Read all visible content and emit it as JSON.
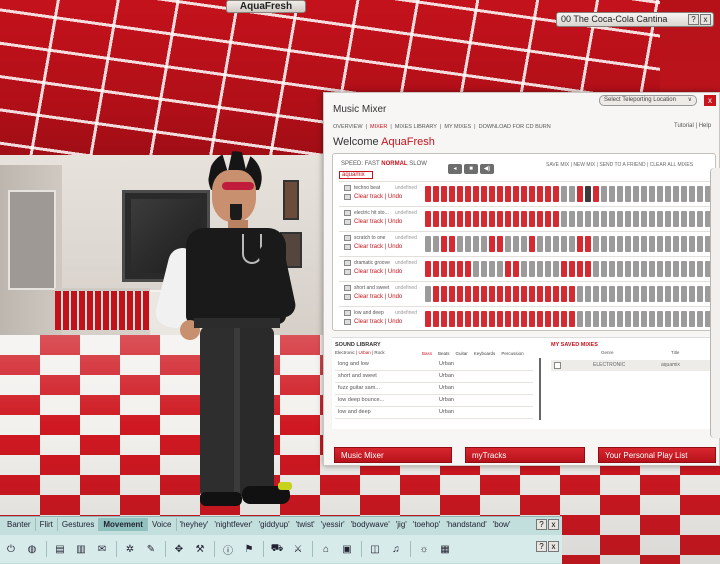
{
  "scene": {
    "avatar_name": "AquaFresh",
    "location": "00 The Coca-Cola Cantina"
  },
  "mixer": {
    "title": "Music Mixer",
    "teleport_label": "Select Teleporting Location",
    "close": "x",
    "nav": [
      "OVERVIEW",
      "MIXER",
      "MIXES LIBRARY",
      "MY MIXES",
      "DOWNLOAD FOR CD BURN"
    ],
    "nav_active": "MIXER",
    "tutorial": "Tutorial",
    "help": "Help",
    "welcome_label": "Welcome",
    "welcome_user": "AquaFresh",
    "speed_label": "SPEED:",
    "speed_fast": "FAST",
    "speed_normal": "NORMAL",
    "speed_slow": "SLOW",
    "transport": {
      "prev": "◂",
      "stop": "■",
      "sound": "◀)"
    },
    "save_links": "SAVE MIX | NEW MIX | SEND TO A FRIEND | CLEAR ALL MIXES",
    "mix_name": "aquamix",
    "clear_label": "Clear track",
    "separator": "|",
    "undo_label": "Undo",
    "tracks": [
      {
        "name": "techno beat",
        "tag": "undefined",
        "pattern": [
          1,
          1,
          1,
          1,
          1,
          1,
          1,
          1,
          1,
          1,
          1,
          1,
          1,
          1,
          1,
          1,
          1,
          0,
          0,
          1,
          2,
          1,
          0,
          0,
          0,
          0,
          0,
          0,
          0,
          0,
          0,
          0,
          0,
          0,
          0,
          0,
          0
        ]
      },
      {
        "name": "electric hit sto...",
        "tag": "undefined",
        "pattern": [
          1,
          1,
          1,
          1,
          1,
          1,
          1,
          1,
          1,
          1,
          1,
          1,
          1,
          1,
          1,
          1,
          1,
          0,
          0,
          0,
          0,
          0,
          0,
          0,
          0,
          0,
          0,
          0,
          0,
          0,
          0,
          0,
          0,
          0,
          0,
          0,
          0
        ]
      },
      {
        "name": "scratch to one",
        "tag": "undefined",
        "pattern": [
          0,
          0,
          1,
          1,
          0,
          0,
          0,
          0,
          1,
          1,
          0,
          0,
          0,
          1,
          0,
          0,
          0,
          0,
          0,
          1,
          1,
          0,
          0,
          0,
          0,
          0,
          0,
          0,
          0,
          0,
          0,
          0,
          0,
          0,
          0,
          0,
          0
        ]
      },
      {
        "name": "dramatic groove",
        "tag": "undefined",
        "pattern": [
          1,
          1,
          1,
          1,
          1,
          1,
          0,
          0,
          0,
          0,
          1,
          1,
          0,
          0,
          0,
          0,
          0,
          1,
          1,
          1,
          1,
          0,
          0,
          0,
          0,
          0,
          0,
          0,
          0,
          0,
          0,
          0,
          0,
          0,
          0,
          0,
          0
        ]
      },
      {
        "name": "short and sweet",
        "tag": "undefined",
        "pattern": [
          0,
          1,
          1,
          1,
          1,
          1,
          1,
          1,
          1,
          1,
          1,
          1,
          1,
          1,
          1,
          1,
          1,
          1,
          1,
          0,
          0,
          0,
          0,
          0,
          0,
          0,
          0,
          0,
          0,
          0,
          0,
          0,
          0,
          0,
          0,
          0,
          0
        ]
      },
      {
        "name": "low and deep",
        "tag": "undefined",
        "pattern": [
          1,
          1,
          1,
          1,
          1,
          1,
          1,
          1,
          1,
          1,
          1,
          1,
          1,
          1,
          1,
          1,
          1,
          1,
          1,
          0,
          0,
          0,
          0,
          0,
          0,
          0,
          0,
          0,
          0,
          0,
          0,
          0,
          0,
          0,
          0,
          0,
          0
        ]
      }
    ],
    "library": {
      "title": "SOUND LIBRARY",
      "filters": [
        "Electronic",
        "Urban",
        "Rock"
      ],
      "filter_active": "Urban",
      "categories": [
        "Bass",
        "Beats",
        "Guitar",
        "Keyboards",
        "Percussion"
      ],
      "category_active": "Bass",
      "sounds": [
        {
          "name": "long and low",
          "genre": "Urban"
        },
        {
          "name": "short and sweet",
          "genre": "Urban"
        },
        {
          "name": "fuzz guitar sam...",
          "genre": "Urban"
        },
        {
          "name": "low deep bounce...",
          "genre": "Urban"
        },
        {
          "name": "low and deep",
          "genre": "Urban"
        }
      ]
    },
    "saved": {
      "title": "MY SAVED MIXES",
      "col_genre": "Genre",
      "col_title": "Title",
      "row_genre": "ELECTRONIC",
      "row_title": "aquamix"
    },
    "buttons": {
      "music_mixer": "Music Mixer",
      "my_tracks": "myTracks",
      "playlist": "Your Personal Play List"
    }
  },
  "toolbar": {
    "tabs": [
      "Banter",
      "Flirt",
      "Gestures",
      "Movement",
      "Voice"
    ],
    "active_tab": "Movement",
    "gestures": [
      "'heyhey'",
      "'nightfever'",
      "'giddyup'",
      "'twist'",
      "'yessir'",
      "'bodywave'",
      "'jig'",
      "'toehop'",
      "'handstand'",
      "'bow'"
    ],
    "help": "?",
    "close": "x"
  }
}
